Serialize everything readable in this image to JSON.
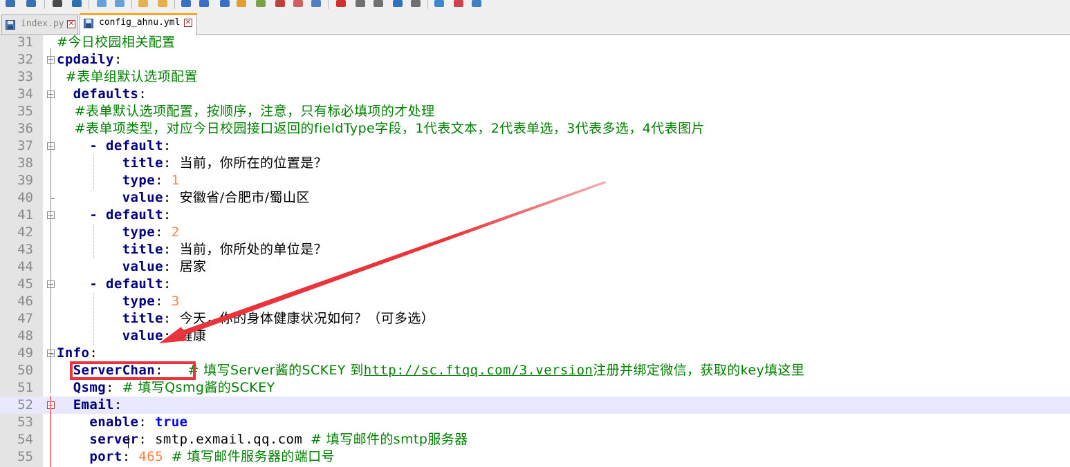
{
  "tabs": [
    {
      "label": "index.py",
      "active": false
    },
    {
      "label": "config_ahnu.yml",
      "active": true
    }
  ],
  "lines": [
    {
      "n": "31",
      "segs": [
        {
          "t": "#今日校园相关配置",
          "c": "cmt"
        }
      ]
    },
    {
      "n": "32",
      "segs": [
        {
          "t": "cpdaily",
          "c": "key"
        },
        {
          "t": ":",
          "c": "valm"
        }
      ]
    },
    {
      "n": "33",
      "segs": [
        {
          "t": "  #表单组默认选项配置",
          "c": "cmt"
        }
      ]
    },
    {
      "n": "34",
      "segs": [
        {
          "t": "  ",
          "c": "valm"
        },
        {
          "t": "defaults",
          "c": "key"
        },
        {
          "t": ":",
          "c": "valm"
        }
      ]
    },
    {
      "n": "35",
      "segs": [
        {
          "t": "    #表单默认选项配置，按顺序，注意，只有标必填项的才处理",
          "c": "cmt"
        }
      ]
    },
    {
      "n": "36",
      "segs": [
        {
          "t": "    #表单项类型，对应今日校园接口返回的fieldType字段，1代表文本，2代表单选，3代表多选，4代表图片",
          "c": "cmt"
        }
      ]
    },
    {
      "n": "37",
      "segs": [
        {
          "t": "    - ",
          "c": "key"
        },
        {
          "t": "default",
          "c": "key"
        },
        {
          "t": ":",
          "c": "valm"
        }
      ]
    },
    {
      "n": "38",
      "segs": [
        {
          "t": "        ",
          "c": "valm"
        },
        {
          "t": "title",
          "c": "key"
        },
        {
          "t": ": ",
          "c": "valm"
        },
        {
          "t": "当前，你所在的位置是？",
          "c": "val"
        }
      ]
    },
    {
      "n": "39",
      "segs": [
        {
          "t": "        ",
          "c": "valm"
        },
        {
          "t": "type",
          "c": "key"
        },
        {
          "t": ": ",
          "c": "valm"
        },
        {
          "t": "1",
          "c": "num"
        }
      ]
    },
    {
      "n": "40",
      "segs": [
        {
          "t": "        ",
          "c": "valm"
        },
        {
          "t": "value",
          "c": "key"
        },
        {
          "t": ": ",
          "c": "valm"
        },
        {
          "t": "安徽省/合肥市/蜀山区",
          "c": "val"
        }
      ]
    },
    {
      "n": "41",
      "segs": [
        {
          "t": "    - ",
          "c": "key"
        },
        {
          "t": "default",
          "c": "key"
        },
        {
          "t": ":",
          "c": "valm"
        }
      ]
    },
    {
      "n": "42",
      "segs": [
        {
          "t": "        ",
          "c": "valm"
        },
        {
          "t": "type",
          "c": "key"
        },
        {
          "t": ": ",
          "c": "valm"
        },
        {
          "t": "2",
          "c": "num"
        }
      ]
    },
    {
      "n": "43",
      "segs": [
        {
          "t": "        ",
          "c": "valm"
        },
        {
          "t": "title",
          "c": "key"
        },
        {
          "t": ": ",
          "c": "valm"
        },
        {
          "t": "当前，你所处的单位是？",
          "c": "val"
        }
      ]
    },
    {
      "n": "44",
      "segs": [
        {
          "t": "        ",
          "c": "valm"
        },
        {
          "t": "value",
          "c": "key"
        },
        {
          "t": ": ",
          "c": "valm"
        },
        {
          "t": "居家",
          "c": "val"
        }
      ]
    },
    {
      "n": "45",
      "segs": [
        {
          "t": "    - ",
          "c": "key"
        },
        {
          "t": "default",
          "c": "key"
        },
        {
          "t": ":",
          "c": "valm"
        }
      ]
    },
    {
      "n": "46",
      "segs": [
        {
          "t": "        ",
          "c": "valm"
        },
        {
          "t": "type",
          "c": "key"
        },
        {
          "t": ": ",
          "c": "valm"
        },
        {
          "t": "3",
          "c": "num"
        }
      ]
    },
    {
      "n": "47",
      "segs": [
        {
          "t": "        ",
          "c": "valm"
        },
        {
          "t": "title",
          "c": "key"
        },
        {
          "t": ": ",
          "c": "valm"
        },
        {
          "t": "今天，你的身体健康状况如何？（可多选）",
          "c": "val"
        }
      ]
    },
    {
      "n": "48",
      "segs": [
        {
          "t": "        ",
          "c": "valm"
        },
        {
          "t": "value",
          "c": "key"
        },
        {
          "t": ": ",
          "c": "valm"
        },
        {
          "t": "健康",
          "c": "val"
        }
      ]
    },
    {
      "n": "49",
      "segs": [
        {
          "t": "Info",
          "c": "key"
        },
        {
          "t": ":",
          "c": "valm"
        }
      ]
    },
    {
      "n": "50",
      "segs": [
        {
          "t": "  ",
          "c": "valm"
        },
        {
          "t": "ServerChan",
          "c": "key"
        },
        {
          "t": ":   ",
          "c": "valm"
        },
        {
          "t": "# 填写Server酱的SCKEY 到",
          "c": "cmt"
        },
        {
          "t": "http://sc.ftqq.com/3.version",
          "c": "link"
        },
        {
          "t": "注册并绑定微信，获取的key填这里",
          "c": "cmt"
        }
      ]
    },
    {
      "n": "51",
      "segs": [
        {
          "t": "  ",
          "c": "valm"
        },
        {
          "t": "Qsmg",
          "c": "key"
        },
        {
          "t": ": ",
          "c": "valm"
        },
        {
          "t": "# 填写Qsmg酱的SCKEY",
          "c": "cmt"
        }
      ]
    },
    {
      "n": "52",
      "segs": [
        {
          "t": "  ",
          "c": "valm"
        },
        {
          "t": "Email",
          "c": "key"
        },
        {
          "t": ":",
          "c": "valm"
        }
      ]
    },
    {
      "n": "53",
      "segs": [
        {
          "t": "    ",
          "c": "valm"
        },
        {
          "t": "enable",
          "c": "key"
        },
        {
          "t": ": ",
          "c": "valm"
        },
        {
          "t": "true",
          "c": "bool"
        }
      ]
    },
    {
      "n": "54",
      "segs": [
        {
          "t": "    ",
          "c": "valm"
        },
        {
          "t": "server",
          "c": "key"
        },
        {
          "t": ": ",
          "c": "valm"
        },
        {
          "t": "smtp.exmail.qq.com ",
          "c": "valm"
        },
        {
          "t": "# 填写邮件的smtp服务器",
          "c": "cmt"
        }
      ]
    },
    {
      "n": "55",
      "segs": [
        {
          "t": "    ",
          "c": "valm"
        },
        {
          "t": "port",
          "c": "key"
        },
        {
          "t": ": ",
          "c": "valm"
        },
        {
          "t": "465",
          "c": "num"
        },
        {
          "t": " ",
          "c": "valm"
        },
        {
          "t": "# 填写邮件服务器的端口号",
          "c": "cmt"
        }
      ]
    }
  ],
  "highlighted_line": "52",
  "annotation": {
    "arrow_color": "#e8343a",
    "box_color": "#e8343a"
  }
}
